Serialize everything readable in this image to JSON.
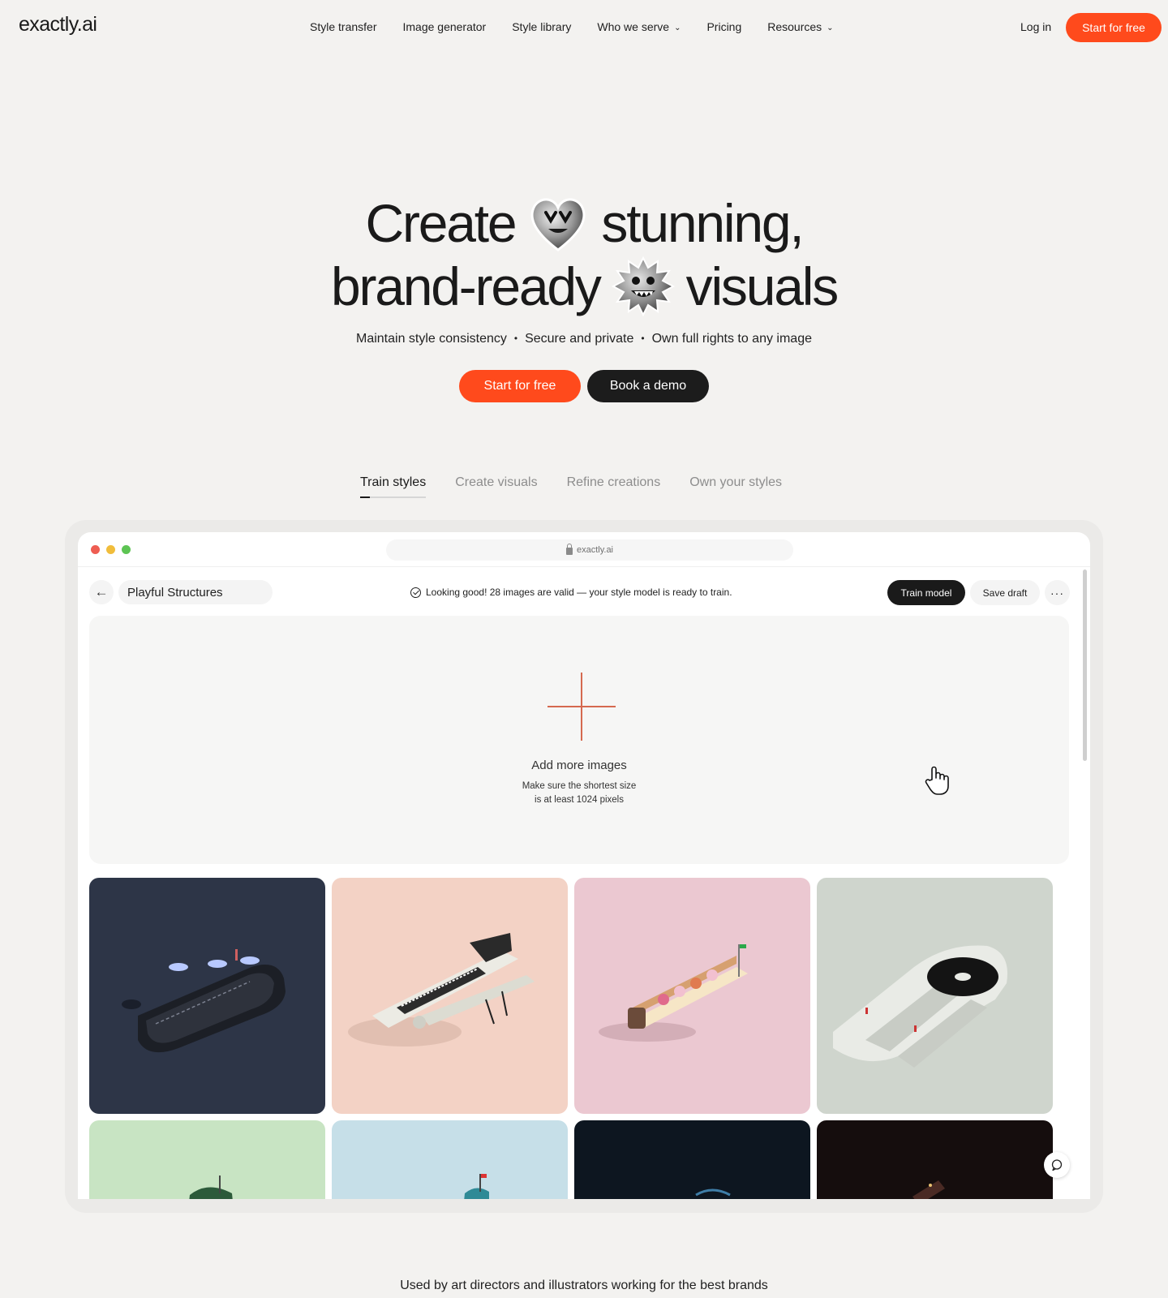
{
  "nav": {
    "logo": "exactly.ai",
    "links": [
      {
        "label": "Style transfer"
      },
      {
        "label": "Image generator"
      },
      {
        "label": "Style library"
      },
      {
        "label": "Who we serve"
      },
      {
        "label": "Pricing"
      },
      {
        "label": "Resources"
      }
    ],
    "login": "Log in",
    "cta": "Start for free"
  },
  "hero": {
    "title_word_1": "Create",
    "title_word_2": "stunning,",
    "title_word_3": "brand-ready",
    "title_word_4": "visuals",
    "features": [
      "Maintain style consistency",
      "Secure and private",
      "Own full rights to any image"
    ],
    "primary_btn": "Start for free",
    "secondary_btn": "Book a demo"
  },
  "tabs": [
    {
      "label": "Train styles",
      "active": true
    },
    {
      "label": "Create visuals"
    },
    {
      "label": "Refine creations"
    },
    {
      "label": "Own your styles"
    }
  ],
  "app": {
    "url": "exactly.ai",
    "project_name": "Playful Structures",
    "status": "Looking good! 28 images are valid — your style model is ready to train.",
    "train_btn": "Train model",
    "draft_btn": "Save draft",
    "more_btn": "···",
    "dropzone": {
      "title": "Add more images",
      "hint_line_1": "Make sure the shortest size",
      "hint_line_2": "is at least 1024 pixels"
    },
    "tile_colors": [
      "#2d3547",
      "#f3d2c5",
      "#ebc8d1",
      "#cfd5cd",
      "#c8e4c3",
      "#c6dfe8",
      "#0d1620",
      "#150d0d"
    ]
  },
  "colors": {
    "accent": "#ff4a1c",
    "dark": "#1c1c1c",
    "background": "#f3f2f0"
  },
  "footer": {
    "tagline": "Used by art directors and illustrators working for the best brands"
  }
}
